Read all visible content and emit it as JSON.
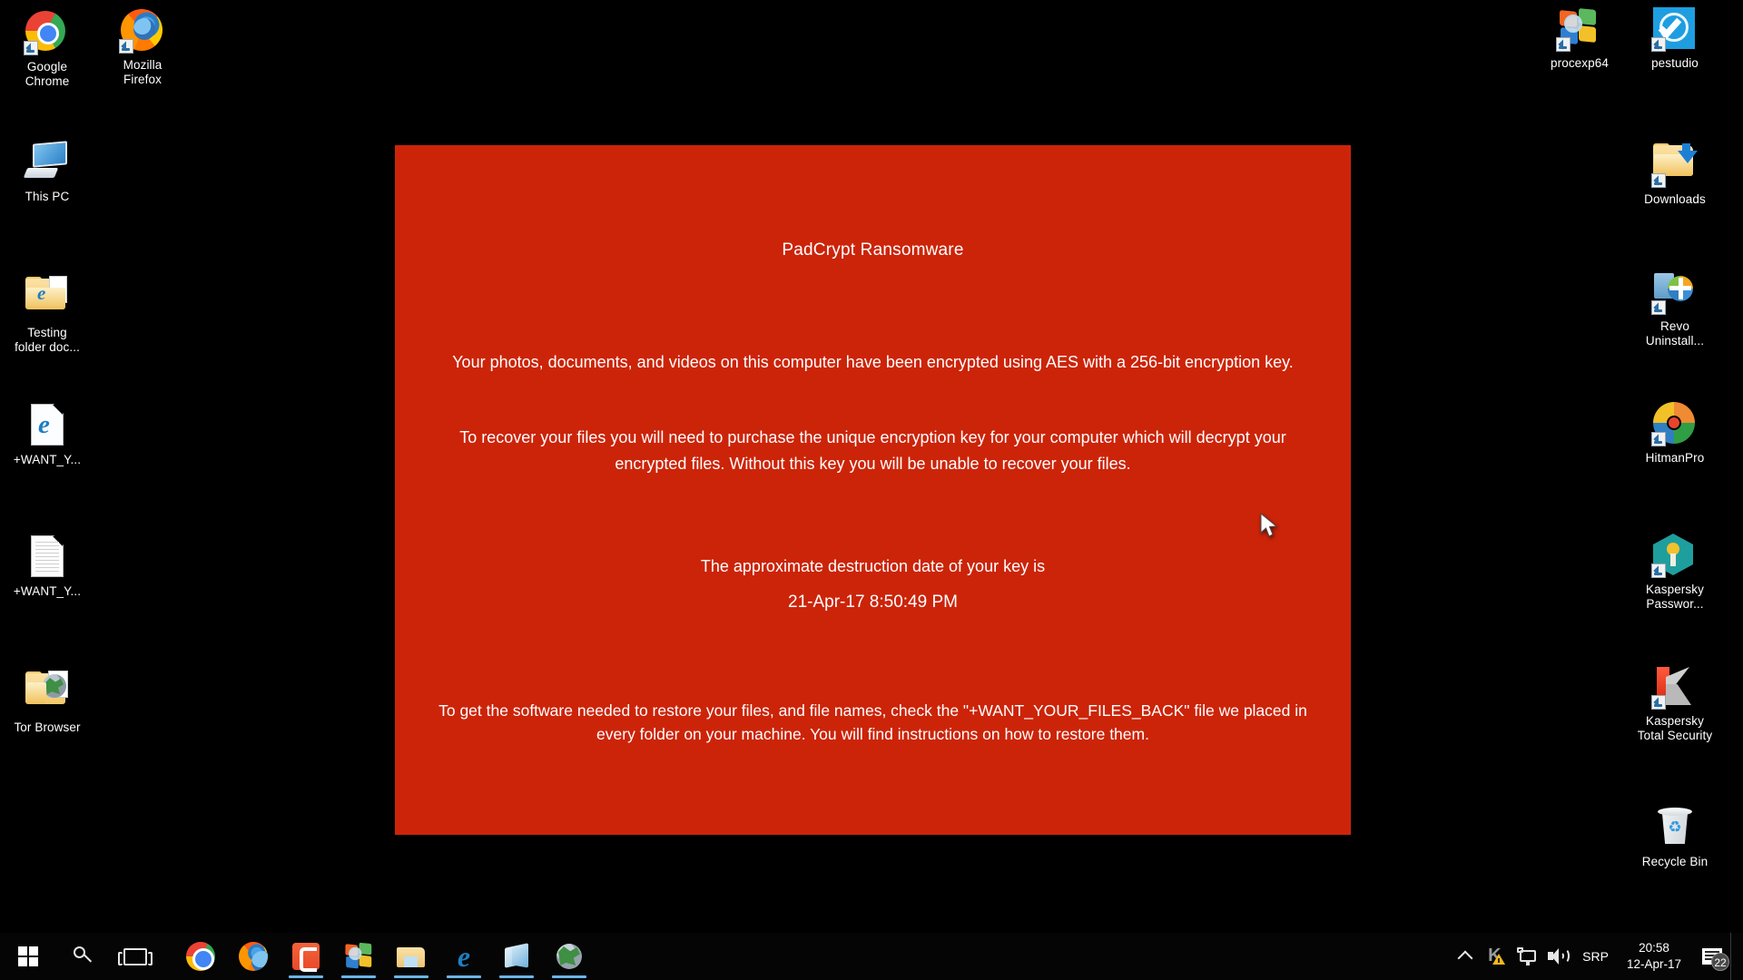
{
  "desktop": {
    "background_color": "#000000",
    "icons_left": [
      {
        "label": "Google\nChrome",
        "name": "google-chrome",
        "icon": "chrome-icon"
      },
      {
        "label": "Mozilla\nFirefox",
        "name": "mozilla-firefox",
        "icon": "firefox-icon"
      },
      {
        "label": "This PC",
        "name": "this-pc",
        "icon": "computer-icon"
      },
      {
        "label": "Testing folder doc...",
        "name": "testing-folder-doc",
        "icon": "folder-icon"
      },
      {
        "label": "+WANT_Y...",
        "name": "want-your-files-back-html",
        "icon": "edge-document-icon"
      },
      {
        "label": "+WANT_Y...",
        "name": "want-your-files-back-txt",
        "icon": "text-document-icon"
      },
      {
        "label": "Tor Browser",
        "name": "tor-browser",
        "icon": "folder-globe-icon"
      }
    ],
    "icons_right": [
      {
        "label": "procexp64",
        "name": "procexp64",
        "icon": "process-explorer-icon"
      },
      {
        "label": "pestudio",
        "name": "pestudio",
        "icon": "pestudio-icon"
      },
      {
        "label": "Downloads",
        "name": "downloads",
        "icon": "downloads-folder-icon"
      },
      {
        "label": "Revo Uninstall...",
        "name": "revo-uninstaller",
        "icon": "revo-uninstaller-icon"
      },
      {
        "label": "HitmanPro",
        "name": "hitmanpro",
        "icon": "hitmanpro-icon"
      },
      {
        "label": "Kaspersky Passwor...",
        "name": "kaspersky-password-manager",
        "icon": "kaspersky-key-icon"
      },
      {
        "label": "Kaspersky Total Security",
        "name": "kaspersky-total-security",
        "icon": "kaspersky-k-icon"
      },
      {
        "label": "Recycle Bin",
        "name": "recycle-bin",
        "icon": "recycle-bin-icon"
      }
    ]
  },
  "ransom_dialog": {
    "background_color": "#cc2409",
    "text_color": "#ffffff",
    "title": "PadCrypt Ransomware",
    "paragraph_1": "Your photos, documents, and videos on this computer have been encrypted using AES with a 256-bit encryption key.",
    "paragraph_2": "To recover your files you will need to purchase the unique encryption key for your computer which will decrypt your encrypted files. Without this key you will be unable to recover your files.",
    "destruction_label": "The approximate destruction date of your key is",
    "destruction_date": "21-Apr-17 8:50:49 PM",
    "paragraph_4": "To get the software needed to restore your files, and file names, check the \"+WANT_YOUR_FILES_BACK\" file we placed in every folder on your machine. You will find instructions on how to restore them."
  },
  "taskbar": {
    "background_color": "#050505",
    "start_label": "Start",
    "search_label": "Search",
    "task_view_label": "Task View",
    "items": [
      {
        "label": "Google Chrome",
        "name": "taskbar-chrome",
        "running": false
      },
      {
        "label": "Mozilla Firefox",
        "name": "taskbar-firefox",
        "running": false
      },
      {
        "label": "Camtasia",
        "name": "taskbar-camtasia",
        "running": true
      },
      {
        "label": "Process Explorer",
        "name": "taskbar-procexp",
        "running": true
      },
      {
        "label": "File Explorer",
        "name": "taskbar-file-explorer",
        "running": true
      },
      {
        "label": "Microsoft Edge",
        "name": "taskbar-edge",
        "running": true
      },
      {
        "label": "Microsoft Store",
        "name": "taskbar-store",
        "running": true
      },
      {
        "label": "Tor Browser",
        "name": "taskbar-tor-browser",
        "running": true
      }
    ],
    "tray": {
      "show_hidden_label": "Show hidden icons",
      "kaspersky_label": "Kaspersky Total Security - attention required",
      "network_label": "Network",
      "volume_label": "Speakers",
      "input_indicator": "SRP",
      "clock_time": "20:58",
      "clock_date": "12-Apr-17",
      "action_center_count": "22"
    }
  }
}
